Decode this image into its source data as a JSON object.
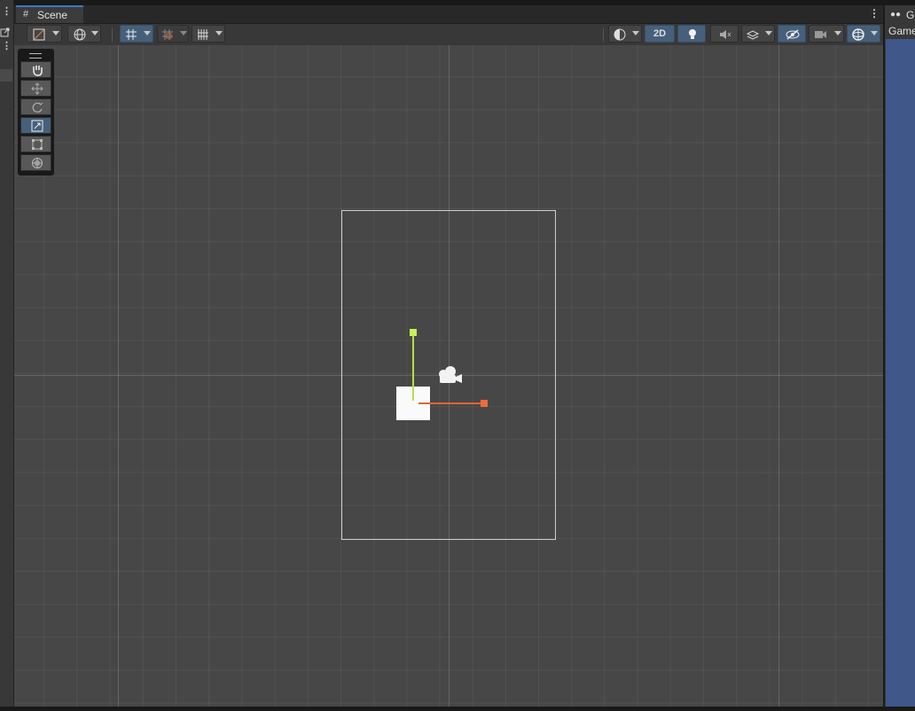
{
  "scene_tab": {
    "label": "Scene",
    "icon": "grid-icon"
  },
  "toolbar": {
    "left": [
      {
        "name": "draw-mode-dropdown",
        "icon": "shading-mode-icon"
      },
      {
        "name": "global-local-dropdown",
        "icon": "globe-icon"
      },
      {
        "name": "grid-snapping-toggle",
        "icon": "grid-snap-icon",
        "active": true
      },
      {
        "name": "increment-snapping-dropdown",
        "icon": "increment-snap-icon"
      },
      {
        "name": "grid-visibility-dropdown",
        "icon": "grid-visibility-icon"
      }
    ],
    "right": [
      {
        "name": "draw-mode-render-dropdown",
        "icon": "render-mode-icon"
      },
      {
        "name": "toggle-2d-button",
        "label": "2D",
        "active": true
      },
      {
        "name": "lighting-toggle",
        "icon": "lightbulb-icon",
        "active": true
      },
      {
        "name": "audio-toggle",
        "icon": "audio-mute-icon"
      },
      {
        "name": "effects-dropdown",
        "icon": "effects-icon"
      },
      {
        "name": "scene-visibility-toggle",
        "icon": "eye-slash-icon",
        "active": true
      },
      {
        "name": "camera-settings-dropdown",
        "icon": "camera-settings-icon"
      },
      {
        "name": "gizmos-dropdown",
        "icon": "gizmo-globe-icon",
        "active": true
      }
    ],
    "twod_label": "2D"
  },
  "tools": [
    {
      "name": "hand-tool",
      "icon": "hand-icon",
      "active": false
    },
    {
      "name": "move-tool",
      "icon": "move-arrows-icon",
      "active": false
    },
    {
      "name": "rotate-tool",
      "icon": "rotate-icon",
      "active": false
    },
    {
      "name": "scale-tool",
      "icon": "scale-icon",
      "active": true
    },
    {
      "name": "rect-tool",
      "icon": "rect-transform-icon",
      "active": false
    },
    {
      "name": "transform-tool",
      "icon": "transform-icon",
      "active": false
    }
  ],
  "right_panel": {
    "tab_label": "G",
    "toolbar_label": "Game",
    "view_color": "#3f5889"
  },
  "colors": {
    "y_axis": "#b4e04a",
    "x_axis": "#e0643c",
    "accent": "#46607c",
    "tab_highlight": "#3a79bb"
  }
}
